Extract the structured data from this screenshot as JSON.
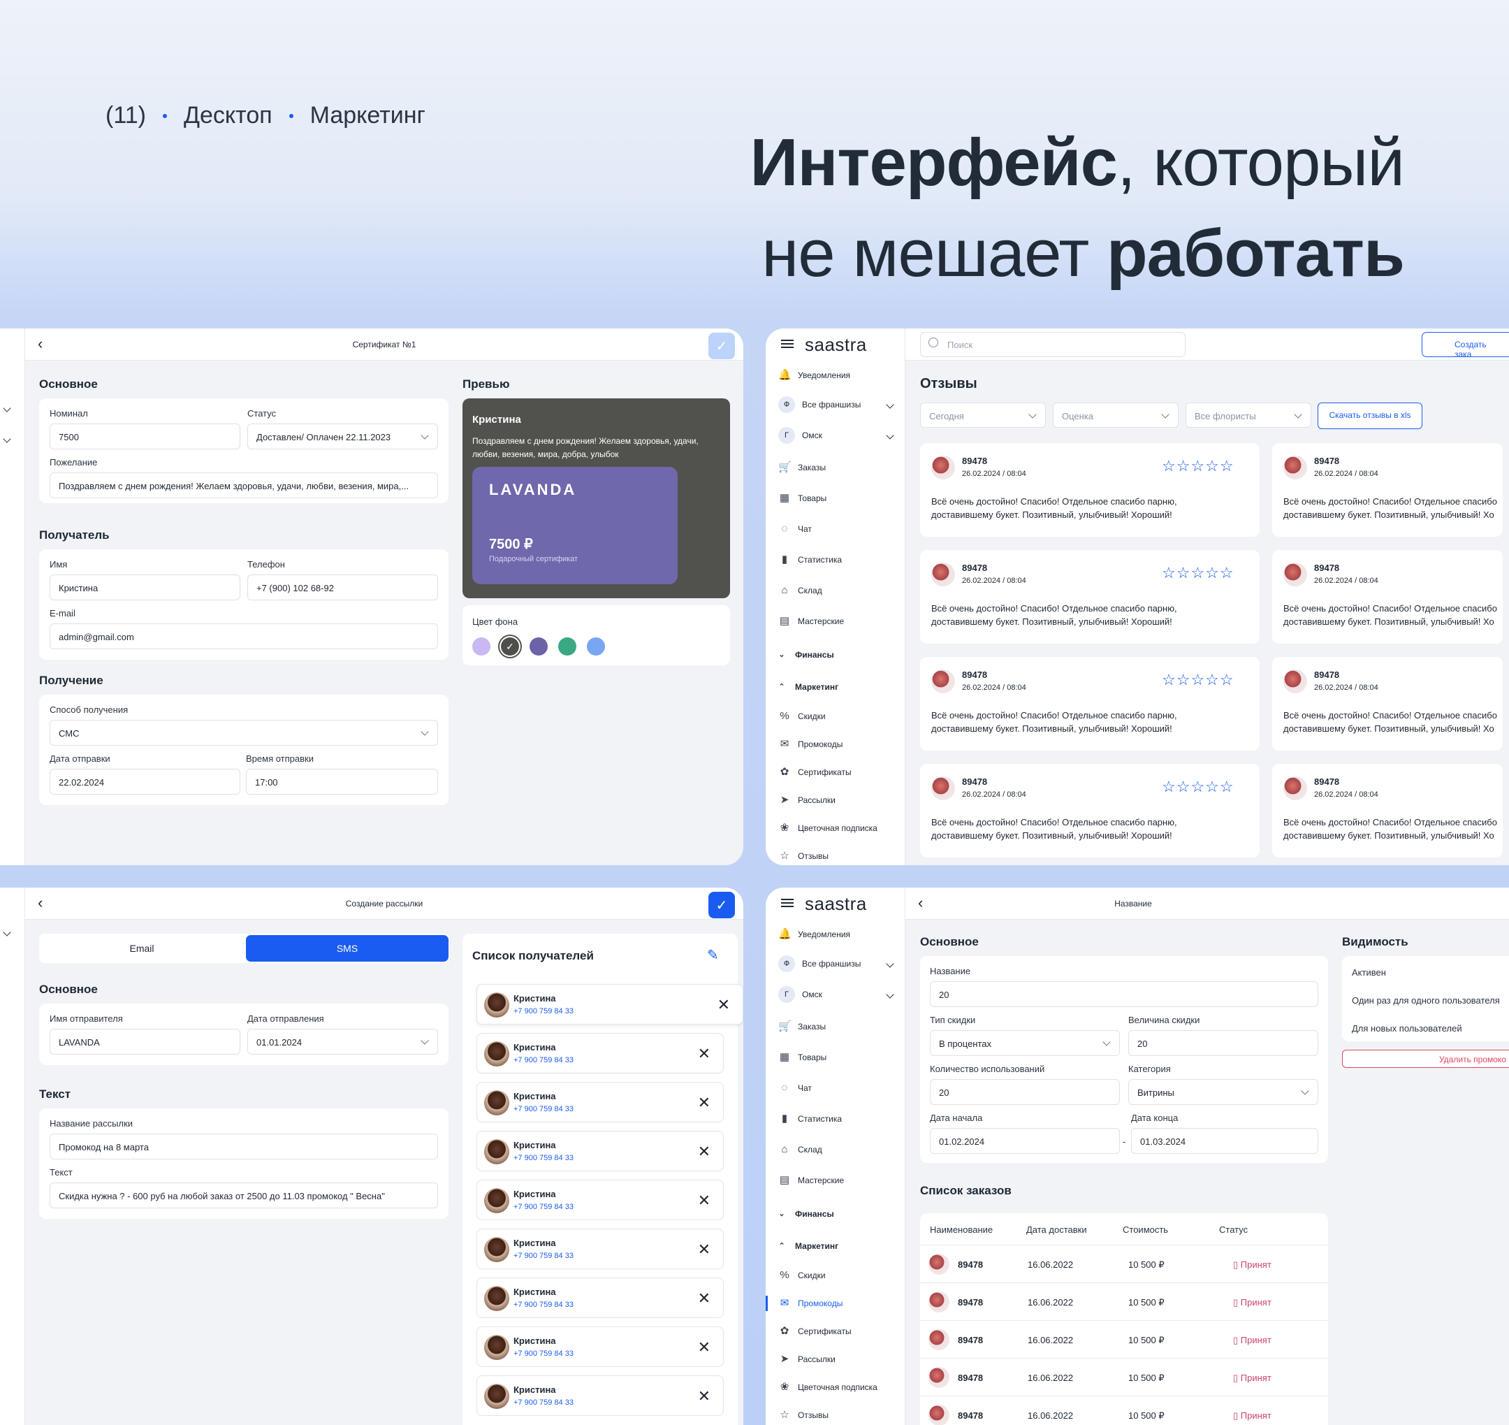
{
  "header": {
    "counter": "(11)",
    "crumb1": "Десктоп",
    "crumb2": "Маркетинг",
    "hero_bold1": "Интерфейс",
    "hero_light1": ", который",
    "hero_light2": "не мешает ",
    "hero_bold2": "работать"
  },
  "cert": {
    "title": "Сертификат №1",
    "main_section": "Основное",
    "nominal_label": "Номинал",
    "nominal_value": "7500",
    "status_label": "Статус",
    "status_value": "Доставлен/ Оплачен 22.11.2023",
    "wish_label": "Пожелание",
    "wish_value": "Поздравляем с днем рождения! Желаем здоровья, удачи, любви, везения, мира,...",
    "recipient_section": "Получатель",
    "name_label": "Имя",
    "name_value": "Кристина",
    "phone_label": "Телефон",
    "phone_value": "+7 (900) 102 68-92",
    "email_label": "E-mail",
    "email_value": "admin@gmail.com",
    "receive_section": "Получение",
    "method_label": "Способ получения",
    "method_value": "СМС",
    "date_label": "Дата отправки",
    "date_value": "22.02.2024",
    "time_label": "Время отправки",
    "time_value": "17:00",
    "preview_section": "Превью",
    "preview_name": "Кристина",
    "preview_text1": "Поздравляем с днем рождения! Желаем здоровья, удачи,",
    "preview_text2": "любви, везения, мира, добра, улыбок",
    "brand": "LAVANDA",
    "amount": "7500 ₽",
    "gift_caption": "Подарочный сертификат",
    "bg_label": "Цвет фона",
    "colors": [
      "#c9b8f2",
      "#4e4f4b",
      "#6b62a8",
      "#3aa883",
      "#78a6f2"
    ]
  },
  "sidebar": {
    "logo": "saastra",
    "items": [
      "Уведомления",
      "Все франшизы",
      "Омск",
      "Заказы",
      "Товары",
      "Чат",
      "Статистика",
      "Склад",
      "Мастерские",
      "Финансы",
      "Маркетинг",
      "Скидки",
      "Промокоды",
      "Сертификаты",
      "Рассылки",
      "Цветочная подписка",
      "Отзывы"
    ],
    "badge_f": "Ф",
    "badge_g": "Г"
  },
  "reviews": {
    "search_placeholder": "Поиск",
    "create_btn": "Создать зака",
    "title": "Отзывы",
    "filter1": "Сегодня",
    "filter2": "Оценка",
    "filter3": "Все флористы",
    "download_btn": "Скачать отзывы в xls",
    "id": "89478",
    "date": "26.02.2024 / 08:04",
    "stars": "☆☆☆☆☆",
    "text1": "Всё очень достойно! Спасибо! Отдельное спасибо парню,",
    "text2": "доставившему букет. Позитивный, улыбчивый! Хороший!",
    "text1_cut": "Всё очень достойно! Спасибо! Отдельное спасибо",
    "text2_cut": "доставившему букет. Позитивный, улыбчивый! Хо"
  },
  "mailing": {
    "title": "Создание рассылки",
    "tab_email": "Email",
    "tab_sms": "SMS",
    "main_section": "Основное",
    "sender_label": "Имя отправителя",
    "sender_value": "LAVANDA",
    "send_date_label": "Дата отправления",
    "send_date_value": "01.01.2024",
    "text_section": "Текст",
    "name_label": "Название рассылки",
    "name_value": "Промокод  на 8 марта",
    "text_label": "Текст",
    "text_value": "Скидка нужна ? -  600 руб на любой заказ от 2500 до 11.03 промокод \" Весна\"",
    "recipients_title": "Список получателей",
    "recipient_name": "Кристина",
    "recipient_phone": "+7 900 759 84 33",
    "recipient_cut": "Кристина"
  },
  "promo": {
    "title": "Название",
    "main_section": "Основное",
    "name_label": "Название",
    "name_value": "20",
    "type_label": "Тип скидки",
    "type_value": "В процентах",
    "size_label": "Величина скидки",
    "size_value": "20",
    "count_label": "Количество использований",
    "count_value": "20",
    "cat_label": "Категория",
    "cat_value": "Витрины",
    "start_label": "Дата начала",
    "start_value": "01.02.2024",
    "end_label": "Дата конца",
    "end_value": "01.03.2024",
    "dash": "-",
    "visibility": "Видимость",
    "vis1": "Активен",
    "vis2": "Один раз для одного пользователя",
    "vis3": "Для новых пользователей",
    "delete_btn": "Удалить промоко",
    "orders_title": "Список заказов",
    "cols": [
      "Наименование",
      "Дата доставки",
      "Стоимость",
      "Статус"
    ],
    "row": {
      "id": "89478",
      "date": "16.06.2022",
      "cost": "10 500 ₽",
      "status": "Принят"
    }
  }
}
